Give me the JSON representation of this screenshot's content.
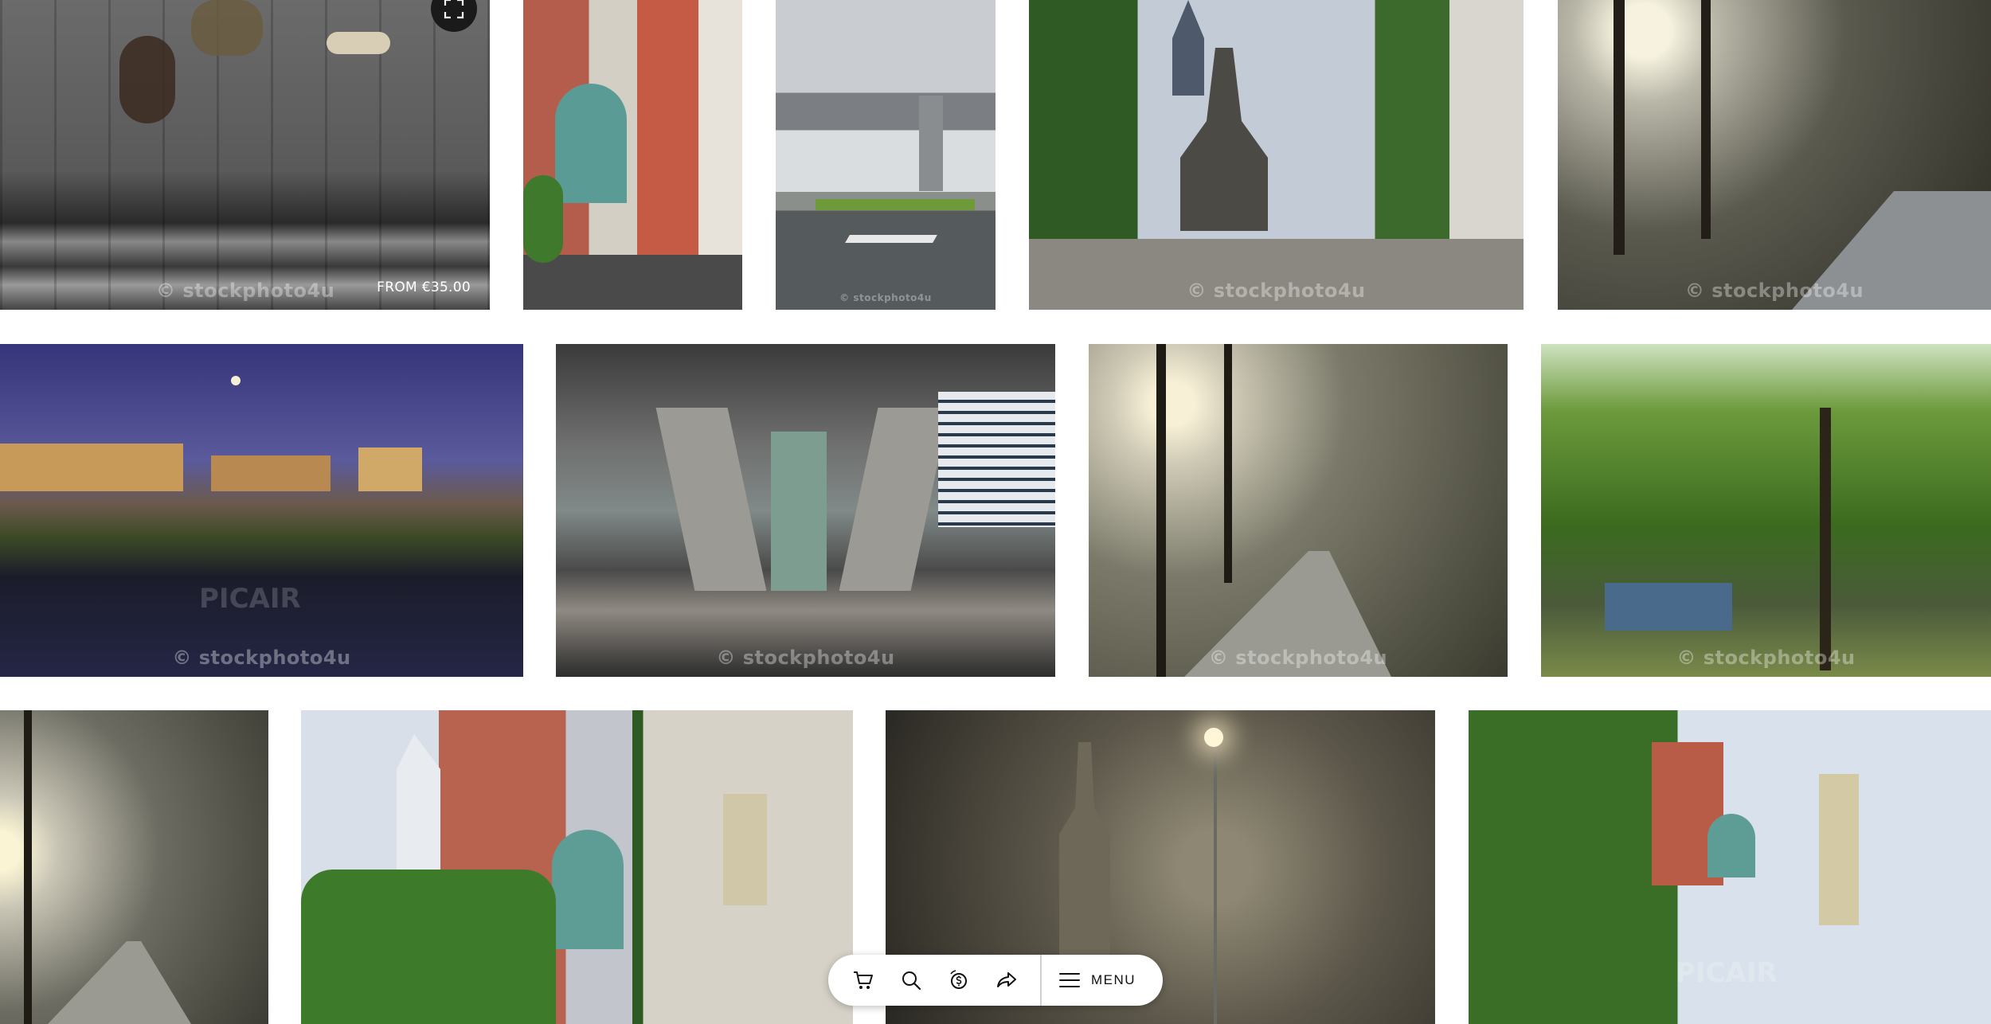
{
  "gallery": {
    "tiles": [
      {
        "watermark": "© stockphoto4u",
        "price": "FROM €35.00"
      },
      {
        "watermark": ""
      },
      {
        "watermark": "© stockphoto4u"
      },
      {
        "watermark": "© stockphoto4u"
      },
      {
        "watermark": "© stockphoto4u"
      },
      {
        "watermark": "© stockphoto4u",
        "overlay": "PICAIR"
      },
      {
        "watermark": "© stockphoto4u"
      },
      {
        "watermark": "© stockphoto4u"
      },
      {
        "watermark": "© stockphoto4u"
      },
      {
        "watermark": ""
      },
      {
        "watermark": ""
      },
      {
        "watermark": ""
      },
      {
        "watermark": "",
        "overlay": "PICAIR"
      }
    ]
  },
  "toolbar": {
    "menu_label": "MENU",
    "icons": [
      "cart-icon",
      "search-icon",
      "currency-icon",
      "share-icon",
      "menu-icon"
    ]
  },
  "expand_icon": "expand-icon"
}
